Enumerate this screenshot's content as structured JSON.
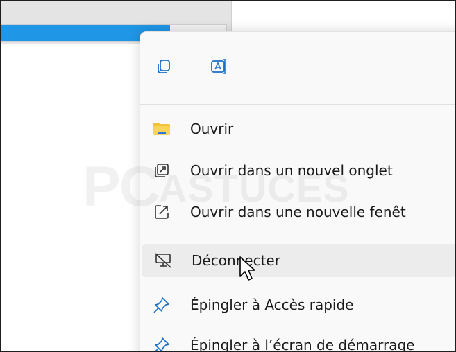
{
  "background": {
    "progress_fraction": 0.75,
    "accent_color": "#1f96e6"
  },
  "toolbar": {
    "copy_icon": "copy-icon",
    "rename_icon": "rename-icon"
  },
  "menu_items": [
    {
      "label": "Ouvrir",
      "icon": "folder-icon"
    },
    {
      "label": "Ouvrir dans un nouvel onglet",
      "icon": "new-tab-icon"
    },
    {
      "label": "Ouvrir dans une nouvelle fenêt",
      "icon": "new-window-icon"
    },
    {
      "label": "Déconnecter",
      "icon": "disconnect-network-icon"
    },
    {
      "label": "Épingler à Accès rapide",
      "icon": "pin-icon"
    },
    {
      "label": "Épingler à l’écran de démarrage",
      "icon": "pin-start-icon"
    }
  ],
  "watermark": {
    "big": "PC",
    "small": "ASTUCES"
  }
}
